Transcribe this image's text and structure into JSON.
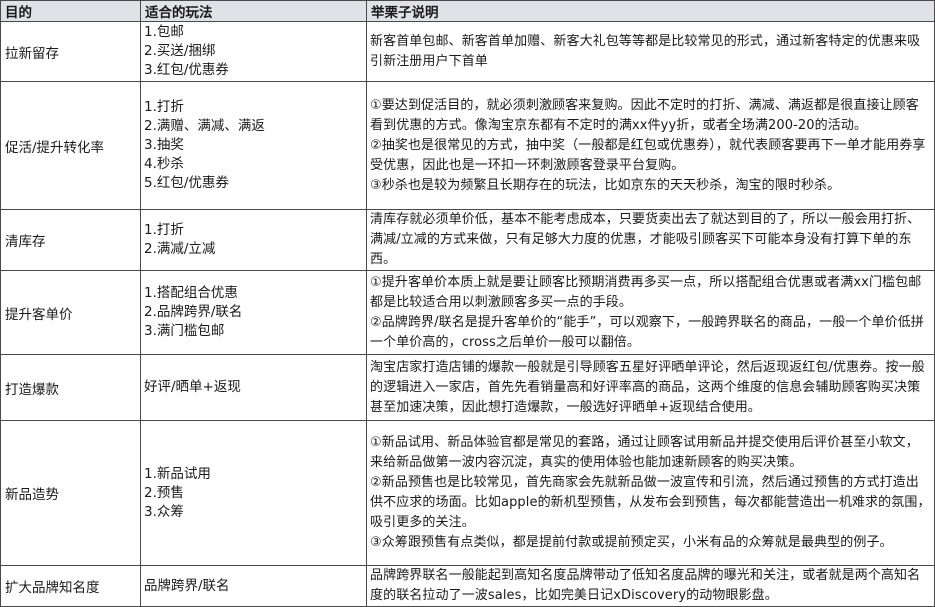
{
  "table": {
    "headers": [
      "目的",
      "适合的玩法",
      "举栗子说明"
    ],
    "rows": [
      {
        "goal": "拉新留存",
        "play": [
          "1.包邮",
          "2.买送/捆绑",
          "3.红包/优惠券"
        ],
        "desc": [
          "新客首单包邮、新客首单加赠、新客大礼包等等都是比较常见的形式，通过新客特定的优惠来吸引新注册用户下首单"
        ]
      },
      {
        "goal": "促活/提升转化率",
        "play": [
          "1.打折",
          "2.满赠、满减、满返",
          "3.抽奖",
          "4.秒杀",
          "5.红包/优惠券"
        ],
        "desc": [
          "①要达到促活目的，就必须刺激顾客来复购。因此不定时的打折、满减、满返都是很直接让顾客看到优惠的方式。像淘宝京东都有不定时的满xx件yy折，或者全场满200-20的活动。",
          "②抽奖也是很常见的方式，抽中奖（一般都是红包或优惠券），就代表顾客要再下一单才能用券享受优惠，因此也是一环扣一环刺激顾客登录平台复购。",
          "③秒杀也是较为频繁且长期存在的玩法，比如京东的天天秒杀，淘宝的限时秒杀。"
        ]
      },
      {
        "goal": "清库存",
        "play": [
          "1.打折",
          "2.满减/立减"
        ],
        "desc": [
          "清库存就必须单价低，基本不能考虑成本，只要货卖出去了就达到目的了，所以一般会用打折、满减/立减的方式来做，只有足够大力度的优惠，才能吸引顾客买下可能本身没有打算下单的东西。"
        ]
      },
      {
        "goal": "提升客单价",
        "play": [
          "1.搭配组合优惠",
          "2.品牌跨界/联名",
          "3.满门槛包邮"
        ],
        "desc": [
          "①提升客单价本质上就是要让顾客比预期消费再多买一点，所以搭配组合优惠或者满xx门槛包邮都是比较适合用以刺激顾客多买一点的手段。",
          "②品牌跨界/联名是提升客单价的“能手”，可以观察下，一般跨界联名的商品，一般一个单价低拼一个单价高的，cross之后单价一般可以翻倍。"
        ]
      },
      {
        "goal": "打造爆款",
        "play": [
          "好评/晒单+返现"
        ],
        "desc": [
          "淘宝店家打造店铺的爆款一般就是引导顾客五星好评晒单评论，然后返现返红包/优惠券。按一般的逻辑进入一家店，首先先看销量高和好评率高的商品，这两个维度的信息会辅助顾客购买决策甚至加速决策，因此想打造爆款，一般选好评晒单+返现结合使用。"
        ]
      },
      {
        "goal": "新品造势",
        "play": [
          "1.新品试用",
          "2.预售",
          "3.众筹"
        ],
        "desc": [
          "①新品试用、新品体验官都是常见的套路，通过让顾客试用新品并提交使用后评价甚至小软文，来给新品做第一波内容沉淀，真实的使用体验也能加速新顾客的购买决策。",
          "②新品预售也是比较常见，首先商家会先就新品做一波宣传和引流，然后通过预售的方式打造出供不应求的场面。比如apple的新机型预售，从发布会到预售，每次都能营造出一机难求的氛围，吸引更多的关注。",
          "③众筹跟预售有点类似，都是提前付款或提前预定买，小米有品的众筹就是最典型的例子。"
        ]
      },
      {
        "goal": "扩大品牌知名度",
        "play": [
          "品牌跨界/联名"
        ],
        "desc": [
          "品牌跨界联名一般能起到高知名度品牌带动了低知名度品牌的曝光和关注，或者就是两个高知名度的联名拉动了一波sales，比如完美日记xDiscovery的动物眼影盘。"
        ]
      }
    ]
  }
}
